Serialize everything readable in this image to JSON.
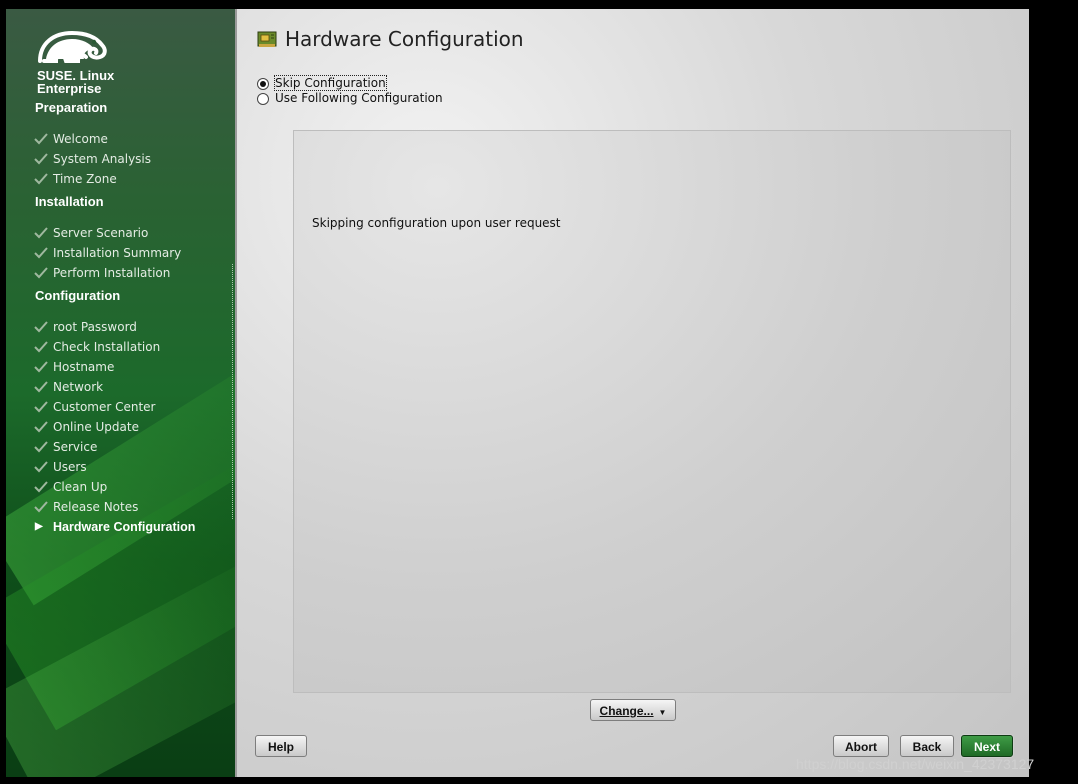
{
  "brand": {
    "logo_text_line1": "SUSE. Linux",
    "logo_text_line2": "Enterprise",
    "accent_color": "#2a7a30"
  },
  "sidebar": {
    "sections": [
      {
        "title": "Preparation",
        "items": [
          {
            "label": "Welcome",
            "state": "done"
          },
          {
            "label": "System Analysis",
            "state": "done"
          },
          {
            "label": "Time Zone",
            "state": "done"
          }
        ]
      },
      {
        "title": "Installation",
        "items": [
          {
            "label": "Server Scenario",
            "state": "done"
          },
          {
            "label": "Installation Summary",
            "state": "done"
          },
          {
            "label": "Perform Installation",
            "state": "done"
          }
        ]
      },
      {
        "title": "Configuration",
        "items": [
          {
            "label": "root Password",
            "state": "done"
          },
          {
            "label": "Check Installation",
            "state": "done"
          },
          {
            "label": "Hostname",
            "state": "done"
          },
          {
            "label": "Network",
            "state": "done"
          },
          {
            "label": "Customer Center",
            "state": "done"
          },
          {
            "label": "Online Update",
            "state": "done"
          },
          {
            "label": "Service",
            "state": "done"
          },
          {
            "label": "Users",
            "state": "done"
          },
          {
            "label": "Clean Up",
            "state": "done"
          },
          {
            "label": "Release Notes",
            "state": "done"
          },
          {
            "label": "Hardware Configuration",
            "state": "current"
          }
        ]
      }
    ]
  },
  "main": {
    "title": "Hardware Configuration",
    "title_icon": "hardware-card-icon",
    "options": [
      {
        "label": "Skip Configuration",
        "selected": true
      },
      {
        "label": "Use Following Configuration",
        "selected": false
      }
    ],
    "info_text": "Skipping configuration upon user request",
    "change_button": "Change...",
    "buttons": {
      "help": "Help",
      "abort": "Abort",
      "back": "Back",
      "next": "Next"
    }
  },
  "watermark": "https://blog.csdn.net/weixin_42373127"
}
